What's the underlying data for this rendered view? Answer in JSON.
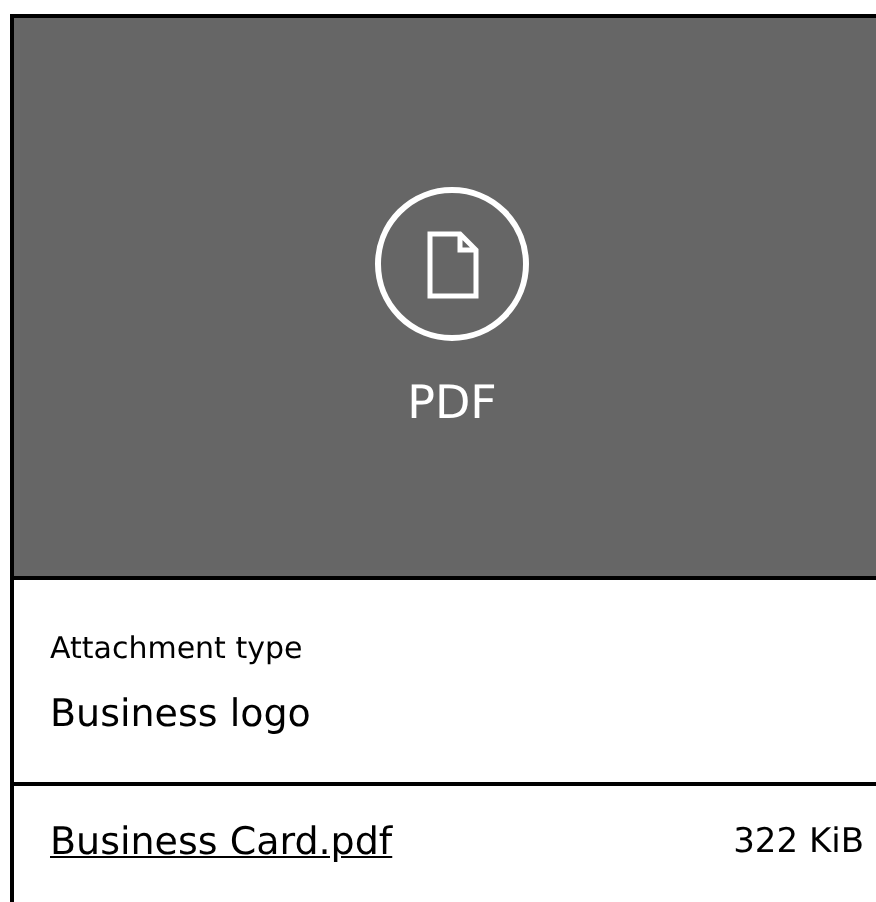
{
  "preview": {
    "label": "PDF"
  },
  "attachment_type": {
    "label": "Attachment type",
    "value": "Business logo"
  },
  "file": {
    "name": "Business Card.pdf",
    "size": "322 KiB"
  }
}
